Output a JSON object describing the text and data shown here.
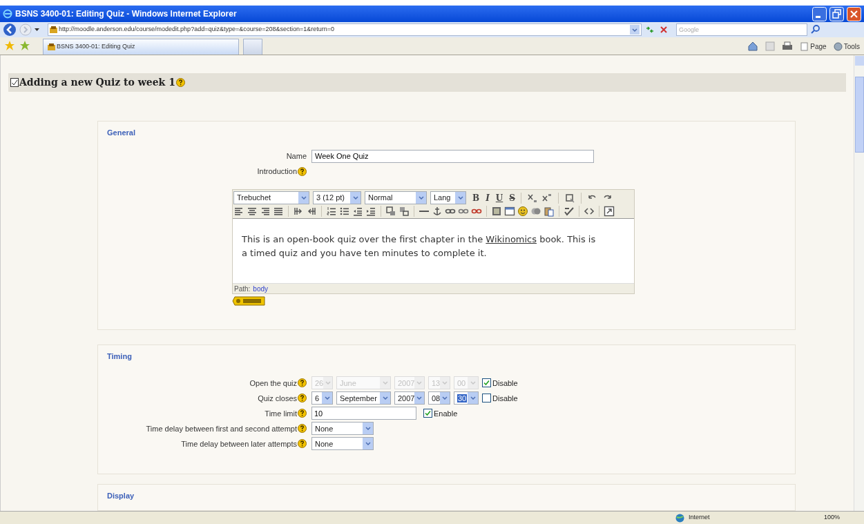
{
  "window": {
    "title": "BSNS 3400-01: Editing Quiz - Windows Internet Explorer"
  },
  "address_bar": {
    "url": "http://moodle.anderson.edu/course/modedit.php?add=quiz&type=&course=208&section=1&return=0"
  },
  "search": {
    "placeholder": "Google"
  },
  "tabs": [
    {
      "label": "BSNS 3400-01: Editing Quiz",
      "selected": true
    }
  ],
  "command_bar": [
    "Page",
    "Tools"
  ],
  "page_title": "Adding a new Quiz to week 1",
  "general": {
    "legend": "General",
    "name_label": "Name",
    "name_value": "Week One Quiz",
    "intro_label": "Introduction",
    "editor": {
      "selects": [
        "Trebuchet",
        "3 (12 pt)",
        "Normal",
        "Lang"
      ],
      "format_buttons": [
        "B",
        "I",
        "U",
        "S"
      ],
      "body": "This is an open-book quiz over the first chapter in the ",
      "link": "Wikinomics",
      "body_end": " book. This is a timed quiz and you have ten minutes to complete it.",
      "path_label": "Path:",
      "path_value": "body"
    }
  },
  "timing": {
    "legend": "Timing",
    "rows": [
      {
        "kind": "date",
        "label": "Open the quiz",
        "disabled": true,
        "parts": [
          {
            "value": "26",
            "focused": false
          },
          {
            "value": "June",
            "focused": false
          },
          {
            "value": "2007",
            "focused": false
          },
          {
            "value": "13",
            "focused": false
          },
          {
            "value": "00",
            "focused": false
          }
        ],
        "check_label": "Disable",
        "checked": true
      },
      {
        "kind": "date",
        "label": "Quiz closes",
        "disabled": false,
        "parts": [
          {
            "value": "6",
            "focused": false
          },
          {
            "value": "September",
            "focused": false
          },
          {
            "value": "2007",
            "focused": false
          },
          {
            "value": "08",
            "focused": false
          },
          {
            "value": "30",
            "focused": true
          }
        ],
        "check_label": "Disable",
        "checked": false
      },
      {
        "kind": "text",
        "label": "Time limit",
        "value": "10",
        "check_label": "Enable",
        "checked": true
      },
      {
        "kind": "select",
        "label": "Time delay between first and second attempt",
        "value": "None"
      },
      {
        "kind": "select",
        "label": "Time delay between later attempts",
        "value": "None"
      }
    ]
  },
  "display": {
    "legend": "Display"
  },
  "status_bar": {
    "zone": "Internet",
    "zoom": "100%"
  }
}
